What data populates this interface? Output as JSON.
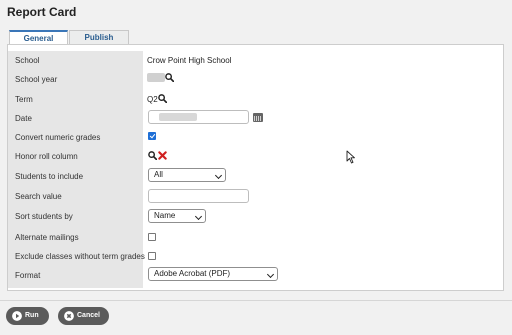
{
  "page": {
    "title": "Report Card"
  },
  "tabs": [
    {
      "label": "General",
      "active": true
    },
    {
      "label": "Publish",
      "active": false
    }
  ],
  "form": {
    "school": {
      "label": "School",
      "value": "Crow Point High School"
    },
    "school_year": {
      "label": "School year"
    },
    "term": {
      "label": "Term",
      "value": "Q2"
    },
    "date": {
      "label": "Date"
    },
    "convert_numeric": {
      "label": "Convert numeric grades",
      "checked": true
    },
    "honor_roll": {
      "label": "Honor roll column"
    },
    "students_to_include": {
      "label": "Students to include",
      "value": "All"
    },
    "search_value": {
      "label": "Search value",
      "value": ""
    },
    "sort_students_by": {
      "label": "Sort students by",
      "value": "Name"
    },
    "alternate_mailings": {
      "label": "Alternate mailings",
      "checked": false
    },
    "exclude_classes": {
      "label": "Exclude classes without term grades",
      "checked": false
    },
    "format": {
      "label": "Format",
      "value": "Adobe Acrobat (PDF)"
    }
  },
  "buttons": {
    "run": "Run",
    "cancel": "Cancel"
  },
  "icons": {
    "search": "magnifier-icon",
    "clear": "red-x-icon",
    "calendar": "calendar-icon",
    "run": "play-circle-icon",
    "cancel": "x-circle-icon"
  },
  "colors": {
    "accent": "#3a76b8",
    "checkbox": "#1e6fd6",
    "button": "#5b5b5b",
    "clear": "#d02020"
  }
}
